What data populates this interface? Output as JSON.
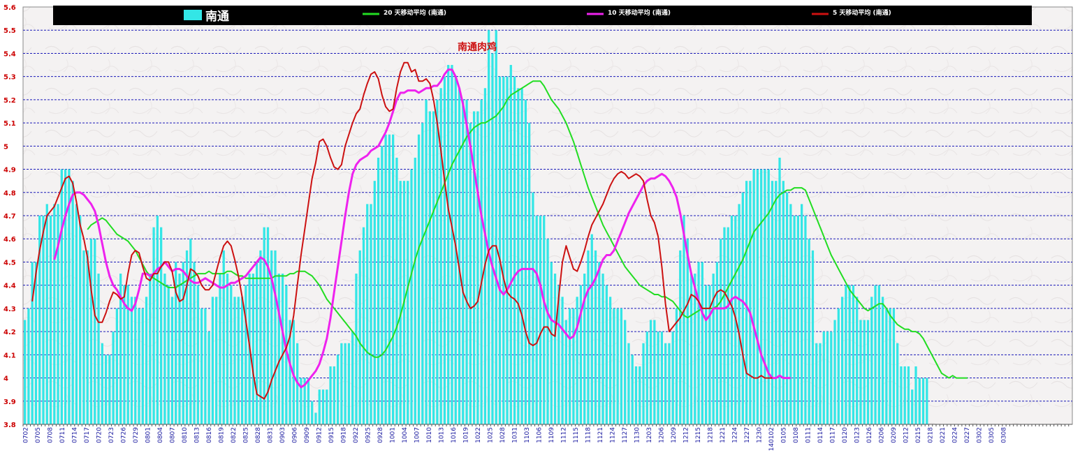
{
  "chart_data": {
    "type": "bar",
    "title": "南通肉鸡",
    "xlabel": "",
    "ylabel": "",
    "ylim": [
      3.8,
      5.6
    ],
    "yticks": [
      "3.8",
      "3.9",
      "4",
      "4.1",
      "4.2",
      "4.3",
      "4.4",
      "4.5",
      "4.6",
      "4.7",
      "4.8",
      "4.9",
      "5",
      "5.1",
      "5.2",
      "5.3",
      "5.4",
      "5.5",
      "5.6"
    ],
    "grid": true,
    "legend_placement": "top",
    "x_tick_labels": [
      "0702",
      "0705",
      "0708",
      "0711",
      "0714",
      "0717",
      "0720",
      "0723",
      "0726",
      "0729",
      "0801",
      "0804",
      "0807",
      "0810",
      "0813",
      "0816",
      "0819",
      "0822",
      "0825",
      "0828",
      "0831",
      "0903",
      "0906",
      "0909",
      "0912",
      "0915",
      "0918",
      "0922",
      "0925",
      "0928",
      "1001",
      "1004",
      "1007",
      "1010",
      "1013",
      "1016",
      "1019",
      "1022",
      "1025",
      "1028",
      "1031",
      "1103",
      "1106",
      "1109",
      "1112",
      "1115",
      "1118",
      "1121",
      "1124",
      "1127",
      "1130",
      "1203",
      "1206",
      "1209",
      "1212",
      "1215",
      "1218",
      "1221",
      "1224",
      "1227",
      "1230",
      "140102",
      "0105",
      "0108",
      "0111",
      "0114",
      "0117",
      "0120",
      "0123",
      "0126",
      "0206",
      "0209",
      "0212",
      "0215",
      "0218",
      "0221",
      "0224",
      "0227",
      "0302",
      "0305",
      "0308"
    ],
    "bar_series": {
      "name": "南通",
      "color": "#33e6e6",
      "values": [
        4.25,
        4.3,
        4.5,
        4.5,
        4.7,
        4.7,
        4.75,
        4.7,
        4.75,
        4.75,
        4.9,
        4.9,
        4.9,
        4.85,
        4.75,
        4.7,
        4.55,
        4.55,
        4.6,
        4.6,
        4.45,
        4.15,
        4.1,
        4.1,
        4.2,
        4.3,
        4.45,
        4.4,
        4.4,
        4.35,
        4.35,
        4.3,
        4.3,
        4.35,
        4.45,
        4.65,
        4.7,
        4.65,
        4.45,
        4.4,
        4.35,
        4.5,
        4.45,
        4.5,
        4.55,
        4.6,
        4.5,
        4.4,
        4.3,
        4.3,
        4.2,
        4.35,
        4.35,
        4.45,
        4.55,
        4.45,
        4.4,
        4.35,
        4.35,
        4.35,
        4.4,
        4.45,
        4.45,
        4.5,
        4.55,
        4.65,
        4.65,
        4.55,
        4.55,
        4.45,
        4.45,
        4.4,
        4.25,
        4.25,
        4.15,
        4.0,
        4.0,
        4.0,
        3.9,
        3.85,
        3.95,
        3.95,
        3.95,
        4.05,
        4.05,
        4.1,
        4.15,
        4.15,
        4.15,
        4.2,
        4.45,
        4.55,
        4.65,
        4.75,
        4.75,
        4.85,
        4.95,
        5.0,
        5.05,
        5.05,
        5.05,
        4.95,
        4.85,
        4.85,
        4.85,
        4.9,
        4.95,
        5.05,
        5.1,
        5.2,
        5.15,
        5.15,
        5.2,
        5.25,
        5.3,
        5.35,
        5.35,
        5.3,
        5.25,
        5.2,
        5.2,
        5.1,
        5.15,
        5.15,
        5.2,
        5.25,
        5.5,
        5.4,
        5.5,
        5.3,
        5.3,
        5.3,
        5.35,
        5.3,
        5.25,
        5.25,
        5.2,
        5.1,
        4.8,
        4.7,
        4.7,
        4.7,
        4.6,
        4.5,
        4.45,
        4.4,
        4.35,
        4.25,
        4.3,
        4.3,
        4.35,
        4.4,
        4.45,
        4.55,
        4.62,
        4.55,
        4.5,
        4.45,
        4.4,
        4.35,
        4.3,
        4.3,
        4.3,
        4.25,
        4.15,
        4.1,
        4.05,
        4.05,
        4.15,
        4.2,
        4.25,
        4.25,
        4.2,
        4.2,
        4.15,
        4.15,
        4.2,
        4.3,
        4.55,
        4.7,
        4.6,
        4.45,
        4.45,
        4.5,
        4.5,
        4.4,
        4.4,
        4.45,
        4.5,
        4.6,
        4.65,
        4.65,
        4.7,
        4.7,
        4.75,
        4.8,
        4.85,
        4.85,
        4.9,
        4.9,
        4.9,
        4.9,
        4.9,
        4.85,
        4.85,
        4.95,
        4.85,
        4.8,
        4.75,
        4.7,
        4.7,
        4.75,
        4.7,
        4.6,
        4.55,
        4.15,
        4.15,
        4.2,
        4.2,
        4.2,
        4.25,
        4.3,
        4.35,
        4.4,
        4.4,
        4.4,
        4.35,
        4.25,
        4.25,
        4.25,
        4.35,
        4.4,
        4.4,
        4.35,
        4.3,
        4.3,
        4.3,
        4.15,
        4.05,
        4.05,
        4.05,
        3.95,
        4.05,
        4.0,
        4.0,
        4.0,
        3.8
      ]
    },
    "line_series": [
      {
        "name": "20 天移动平均 (南通)",
        "color": "#22dd22",
        "start": 17,
        "values": [
          4.64,
          4.66,
          4.67,
          4.68,
          4.69,
          4.68,
          4.66,
          4.64,
          4.62,
          4.61,
          4.6,
          4.59,
          4.57,
          4.55,
          4.52,
          4.49,
          4.46,
          4.44,
          4.43,
          4.42,
          4.41,
          4.4,
          4.39,
          4.39,
          4.39,
          4.4,
          4.41,
          4.42,
          4.43,
          4.44,
          4.45,
          4.45,
          4.45,
          4.46,
          4.45,
          4.45,
          4.45,
          4.45,
          4.46,
          4.46,
          4.45,
          4.44,
          4.44,
          4.43,
          4.43,
          4.43,
          4.43,
          4.43,
          4.43,
          4.43,
          4.43,
          4.44,
          4.44,
          4.44,
          4.44,
          4.45,
          4.45,
          4.46,
          4.46,
          4.46,
          4.45,
          4.44,
          4.42,
          4.4,
          4.37,
          4.34,
          4.32,
          4.3,
          4.28,
          4.26,
          4.24,
          4.22,
          4.2,
          4.18,
          4.15,
          4.13,
          4.11,
          4.1,
          4.09,
          4.09,
          4.1,
          4.12,
          4.15,
          4.18,
          4.22,
          4.27,
          4.33,
          4.39,
          4.45,
          4.51,
          4.56,
          4.6,
          4.64,
          4.68,
          4.72,
          4.76,
          4.8,
          4.84,
          4.88,
          4.92,
          4.95,
          4.98,
          5.01,
          5.04,
          5.06,
          5.08,
          5.09,
          5.1,
          5.1,
          5.11,
          5.12,
          5.13,
          5.15,
          5.17,
          5.2,
          5.22,
          5.23,
          5.24,
          5.25,
          5.26,
          5.27,
          5.28,
          5.28,
          5.28,
          5.26,
          5.23,
          5.2,
          5.18,
          5.16,
          5.13,
          5.1,
          5.06,
          5.02,
          4.97,
          4.92,
          4.87,
          4.82,
          4.78,
          4.74,
          4.7,
          4.66,
          4.63,
          4.6,
          4.57,
          4.54,
          4.51,
          4.48,
          4.46,
          4.44,
          4.42,
          4.4,
          4.39,
          4.38,
          4.37,
          4.36,
          4.36,
          4.35,
          4.35,
          4.34,
          4.33,
          4.31,
          4.29,
          4.27,
          4.26,
          4.27,
          4.28,
          4.29,
          4.3,
          4.3,
          4.3,
          4.3,
          4.31,
          4.33,
          4.36,
          4.39,
          4.42,
          4.45,
          4.48,
          4.51,
          4.55,
          4.59,
          4.63,
          4.65,
          4.67,
          4.69,
          4.71,
          4.74,
          4.77,
          4.79,
          4.8,
          4.81,
          4.81,
          4.82,
          4.82,
          4.82,
          4.81,
          4.77,
          4.73,
          4.69,
          4.65,
          4.61,
          4.57,
          4.53,
          4.5,
          4.47,
          4.44,
          4.41,
          4.38,
          4.36,
          4.34,
          4.32,
          4.3,
          4.29,
          4.3,
          4.31,
          4.32,
          4.32,
          4.3,
          4.27,
          4.25,
          4.23,
          4.22,
          4.21,
          4.21,
          4.2,
          4.2,
          4.19,
          4.17,
          4.14,
          4.11,
          4.08,
          4.05,
          4.02,
          4.01,
          4.0,
          4.01,
          4.0,
          4.0,
          4.0,
          4.0
        ]
      },
      {
        "name": "10 天移动平均 (南通)",
        "color": "#ee22ee",
        "start": 8,
        "values": [
          4.51,
          4.57,
          4.64,
          4.7,
          4.75,
          4.79,
          4.8,
          4.8,
          4.79,
          4.77,
          4.75,
          4.72,
          4.66,
          4.58,
          4.5,
          4.44,
          4.4,
          4.38,
          4.35,
          4.32,
          4.3,
          4.29,
          4.32,
          4.38,
          4.45,
          4.45,
          4.44,
          4.45,
          4.47,
          4.48,
          4.5,
          4.48,
          4.46,
          4.47,
          4.47,
          4.46,
          4.44,
          4.42,
          4.41,
          4.41,
          4.42,
          4.43,
          4.42,
          4.41,
          4.4,
          4.39,
          4.39,
          4.4,
          4.41,
          4.41,
          4.42,
          4.43,
          4.44,
          4.46,
          4.48,
          4.5,
          4.52,
          4.51,
          4.48,
          4.43,
          4.36,
          4.28,
          4.2,
          4.12,
          4.06,
          4.01,
          3.98,
          3.96,
          3.97,
          3.99,
          4.01,
          4.03,
          4.06,
          4.11,
          4.17,
          4.26,
          4.37,
          4.48,
          4.59,
          4.7,
          4.8,
          4.88,
          4.92,
          4.94,
          4.95,
          4.96,
          4.98,
          4.99,
          5.0,
          5.03,
          5.06,
          5.1,
          5.15,
          5.2,
          5.23,
          5.23,
          5.24,
          5.24,
          5.24,
          5.23,
          5.24,
          5.25,
          5.25,
          5.26,
          5.26,
          5.28,
          5.31,
          5.33,
          5.33,
          5.3,
          5.25,
          5.18,
          5.09,
          5.0,
          4.9,
          4.8,
          4.7,
          4.62,
          4.54,
          4.48,
          4.43,
          4.38,
          4.36,
          4.38,
          4.41,
          4.44,
          4.46,
          4.47,
          4.47,
          4.47,
          4.47,
          4.45,
          4.4,
          4.33,
          4.28,
          4.25,
          4.24,
          4.23,
          4.21,
          4.19,
          4.17,
          4.18,
          4.22,
          4.28,
          4.34,
          4.38,
          4.4,
          4.43,
          4.47,
          4.51,
          4.53,
          4.53,
          4.55,
          4.59,
          4.63,
          4.67,
          4.71,
          4.74,
          4.77,
          4.8,
          4.83,
          4.85,
          4.86,
          4.86,
          4.87,
          4.88,
          4.87,
          4.85,
          4.82,
          4.78,
          4.71,
          4.62,
          4.53,
          4.45,
          4.39,
          4.33,
          4.28,
          4.25,
          4.27,
          4.3,
          4.3,
          4.3,
          4.3,
          4.31,
          4.34,
          4.35,
          4.34,
          4.33,
          4.31,
          4.28,
          4.22,
          4.16,
          4.1,
          4.06,
          4.02,
          4.0,
          4.0,
          4.01,
          4.0,
          4.0,
          4.0
        ]
      },
      {
        "name": "5 天移动平均 (南通)",
        "color": "#cc1111",
        "start": 2,
        "values": [
          4.33,
          4.45,
          4.55,
          4.63,
          4.7,
          4.72,
          4.74,
          4.78,
          4.82,
          4.86,
          4.87,
          4.84,
          4.76,
          4.66,
          4.6,
          4.52,
          4.38,
          4.27,
          4.24,
          4.24,
          4.28,
          4.33,
          4.37,
          4.36,
          4.34,
          4.35,
          4.45,
          4.53,
          4.55,
          4.54,
          4.48,
          4.43,
          4.42,
          4.45,
          4.45,
          4.48,
          4.5,
          4.5,
          4.46,
          4.37,
          4.33,
          4.34,
          4.4,
          4.47,
          4.46,
          4.44,
          4.4,
          4.38,
          4.38,
          4.4,
          4.46,
          4.52,
          4.57,
          4.59,
          4.57,
          4.51,
          4.44,
          4.35,
          4.25,
          4.14,
          4.02,
          3.93,
          3.92,
          3.91,
          3.94,
          3.99,
          4.03,
          4.07,
          4.1,
          4.13,
          4.18,
          4.27,
          4.4,
          4.53,
          4.64,
          4.75,
          4.86,
          4.93,
          5.02,
          5.03,
          5.0,
          4.95,
          4.91,
          4.9,
          4.92,
          5.0,
          5.05,
          5.1,
          5.14,
          5.16,
          5.22,
          5.27,
          5.31,
          5.32,
          5.29,
          5.22,
          5.17,
          5.15,
          5.16,
          5.25,
          5.32,
          5.36,
          5.36,
          5.32,
          5.33,
          5.28,
          5.28,
          5.29,
          5.27,
          5.2,
          5.1,
          4.98,
          4.85,
          4.73,
          4.65,
          4.57,
          4.47,
          4.37,
          4.33,
          4.3,
          4.31,
          4.33,
          4.41,
          4.49,
          4.55,
          4.57,
          4.57,
          4.51,
          4.43,
          4.37,
          4.35,
          4.34,
          4.32,
          4.27,
          4.2,
          4.15,
          4.14,
          4.15,
          4.19,
          4.22,
          4.22,
          4.19,
          4.18,
          4.35,
          4.5,
          4.57,
          4.52,
          4.47,
          4.46,
          4.5,
          4.55,
          4.61,
          4.66,
          4.69,
          4.72,
          4.75,
          4.79,
          4.83,
          4.86,
          4.88,
          4.89,
          4.88,
          4.86,
          4.87,
          4.88,
          4.87,
          4.85,
          4.77,
          4.7,
          4.67,
          4.61,
          4.48,
          4.32,
          4.2,
          4.22,
          4.24,
          4.26,
          4.29,
          4.32,
          4.36,
          4.35,
          4.33,
          4.3,
          4.3,
          4.3,
          4.34,
          4.37,
          4.38,
          4.37,
          4.34,
          4.31,
          4.26,
          4.19,
          4.1,
          4.02,
          4.01,
          4.0,
          4.0,
          4.01,
          4.0,
          4.0,
          4.0
        ]
      }
    ]
  }
}
